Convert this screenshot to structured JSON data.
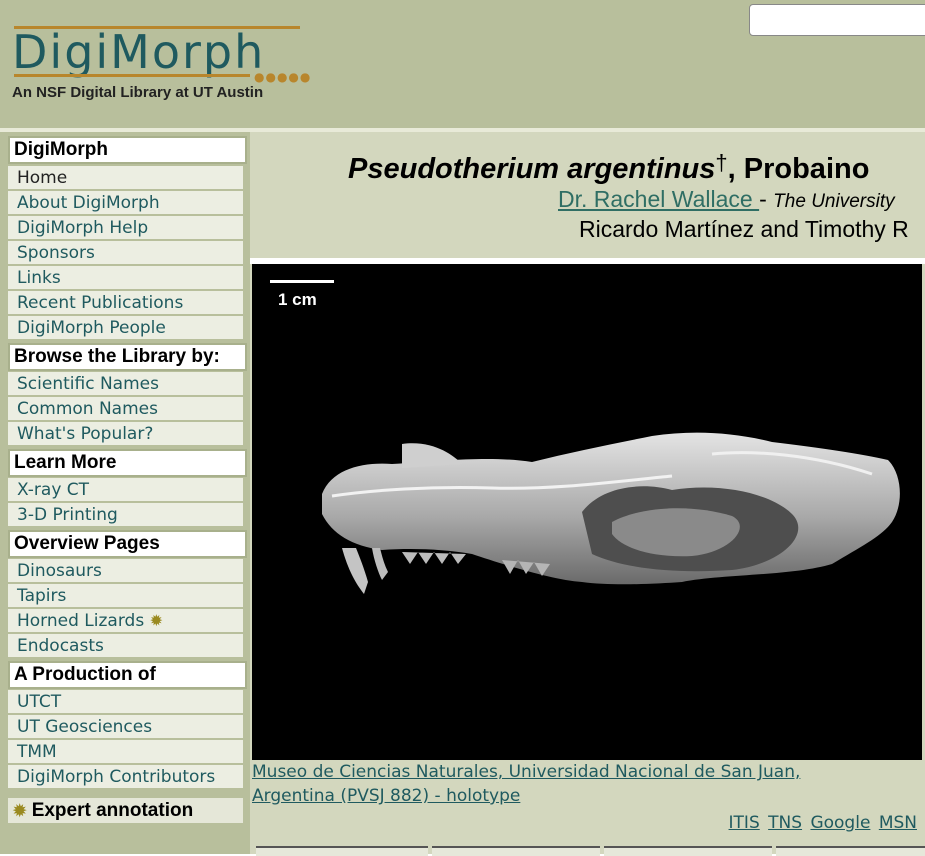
{
  "header": {
    "logo_text": "DigiMorph",
    "tagline": "An NSF Digital Library at UT Austin",
    "search": {
      "value": "",
      "placeholder": ""
    }
  },
  "sidebar": {
    "sections": [
      {
        "title": "DigiMorph",
        "items": [
          "Home",
          "About DigiMorph",
          "DigiMorph Help",
          "Sponsors",
          "Links",
          "Recent Publications",
          "DigiMorph People"
        ]
      },
      {
        "title": "Browse the Library by:",
        "items": [
          "Scientific Names",
          "Common Names",
          "What's Popular?"
        ]
      },
      {
        "title": "Learn More",
        "items": [
          "X-ray CT",
          "3-D Printing"
        ]
      },
      {
        "title": "Overview Pages",
        "items": [
          "Dinosaurs",
          "Tapirs",
          "Horned Lizards",
          "Endocasts"
        ]
      },
      {
        "title": "A Production of",
        "items": [
          "UTCT",
          "UT Geosciences",
          "TMM",
          "DigiMorph Contributors"
        ]
      }
    ],
    "expert_annotation": "Expert annotation",
    "new_icon": "sun-icon"
  },
  "main": {
    "title_species": "Pseudotherium argentinus",
    "title_dagger": "†",
    "title_rest": ", Probaino",
    "author_name": "Dr. Rachel Wallace ",
    "author_sep": " - ",
    "author_institution": "The University",
    "coauthors": "Ricardo Martínez and Timothy R",
    "scale_label": "1 cm",
    "caption_line1": "Museo de Ciencias Naturales, Universidad Nacional de San Juan,",
    "caption_line2": "Argentina (PVSJ 882) - holotype",
    "external_links": [
      "ITIS",
      "TNS",
      "Google",
      "MSN"
    ]
  },
  "colors": {
    "header_bg": "#b8bf9c",
    "main_bg": "#d3d7be",
    "link": "#1f5a5f",
    "accent": "#b8862c"
  }
}
